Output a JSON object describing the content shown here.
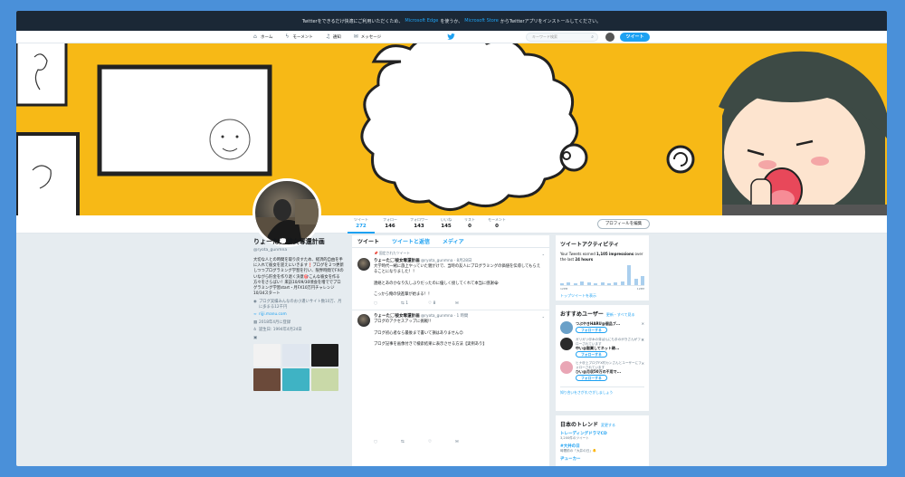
{
  "notice": {
    "prefix": "Twitterをできるだけ快適にご利用いただくため、",
    "link1": "Microsoft Edge",
    "middle": "を使うか、",
    "link2": "Microsoft Store",
    "suffix": "からTwitterアプリをインストールしてください。"
  },
  "nav": {
    "home": "ホーム",
    "moments": "モーメント",
    "notifications": "通知",
    "messages": "メッセージ",
    "search_placeholder": "キーワード検索",
    "tweet_button": "ツイート"
  },
  "stats": [
    {
      "label": "ツイート",
      "value": "272"
    },
    {
      "label": "フォロー",
      "value": "146"
    },
    {
      "label": "フォロワー",
      "value": "143"
    },
    {
      "label": "いいね",
      "value": "145"
    },
    {
      "label": "リスト",
      "value": "0"
    },
    {
      "label": "モーメント",
      "value": "0"
    }
  ],
  "edit_profile": "プロフィールを編集",
  "profile": {
    "name": "りょーた💭彼女奪還計画",
    "handle": "@ryota_gunmna",
    "bio": "大切な人との時間を取り戻すため、経済的自由を手に入れて彼女を迎えにいきます❗️ブログを２つ更新しつつプログラミング学習を行い、限界時間でFXのいながら貯金を作り退く決意🎯こんな彼女を作る方々をさらばい！来訪10/09/30頃会を増ででプログラミング学習start・月FX10万円チャレンジ10/34スタート",
    "location": "ブログ実績みんなのお小遣いサイト数10万、月に多まる12千円",
    "url": "rijji.manu.com",
    "joined": "2018年4月に登録",
    "born": "誕生日: 1994年4月24日"
  },
  "timeline": {
    "tabs": [
      "ツイート",
      "ツイートと返信",
      "メディア"
    ],
    "tweets": [
      {
        "pinned": "固定されたツイート",
        "name": "りょーた💭彼女奪還計画",
        "handle": "@ryota_gunmna",
        "time": "8月28日",
        "text": "大学時代一緒に旅上やっていた親がけで、当時の友人にプログラミングの価値を伝導してもらえることになりました！！\n\n連絡とあのかなり久しぶりだったのに優しく接してくれて本当に感謝😭\n\nこっから俺の快進撃が始まる！！",
        "replies": "",
        "retweets": "1",
        "likes": "8"
      },
      {
        "pinned": "",
        "name": "りょーた💭彼女奪還計画",
        "handle": "@ryota_gunmna",
        "time": "1 時間",
        "text": "ブログのアクセスアップに挑戦!!\n\nブログ初心者なら最後まで書いて損はありません😊\n\nブログ記事を画像付きで検索結果に表示させる方法【実例あり】",
        "replies": "",
        "retweets": "",
        "likes": ""
      }
    ]
  },
  "activity": {
    "title": "ツイートアクティビティ",
    "text_pre": "Your Tweets earned ",
    "impressions": "1,105 impressions",
    "text_mid": " over the last ",
    "period": "24 hours",
    "label_left": "12PM",
    "label_right": "12PM",
    "link": "トップツイートを表示",
    "bars": [
      2,
      3,
      2,
      4,
      3,
      2,
      3,
      2,
      3,
      4,
      20,
      6,
      9
    ]
  },
  "suggest": {
    "title": "おすすめユーザー",
    "extra": "更新・すべて見る",
    "follow": "フォローする",
    "users": [
      {
        "name": "つぶやきHARU@個品ブ...",
        "sub": "",
        "color": "#6aa0c8"
      },
      {
        "name": "中い@副業してネット稼...",
        "sub": "ガリガリ@木の芽ばんにも手のがきさんがフォローされています",
        "color": "#2b2b2b"
      },
      {
        "name": "ひい@月収50万の不用で...",
        "sub": "ヒナ@上ブログFX村カンさんとユーザーにフォローされています",
        "color": "#e9a6b5"
      }
    ],
    "foot": "知り合いをさがす/さがしましょう"
  },
  "trends": {
    "title": "日本のトレンド",
    "extra": "変更する",
    "items": [
      {
        "tag": "トレーディングドラマCD",
        "count": "3,200件のツイート"
      },
      {
        "tag": "#大井の日",
        "count": "時間前の「大井の日」🐥"
      },
      {
        "tag": "ヂューカー",
        "count": ""
      }
    ]
  }
}
